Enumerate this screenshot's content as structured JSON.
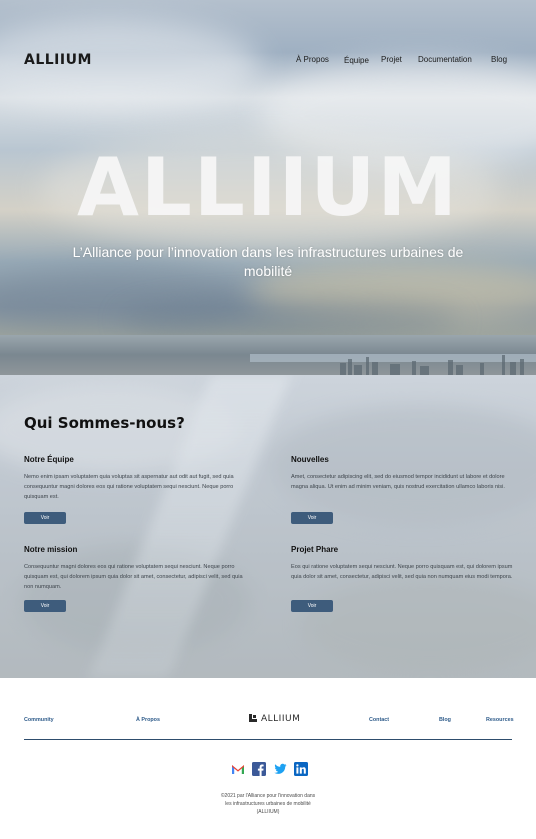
{
  "brand": {
    "logo_text": "ALLIIUM"
  },
  "nav": {
    "items": [
      "À Propos",
      "Équipe",
      "Projet",
      "Documentation",
      "Blog"
    ]
  },
  "hero": {
    "title": "ALLIIUM",
    "subtitle": "L’Alliance pour l’innovation dans les infrastructures urbaines de mobilité"
  },
  "about": {
    "title": "Qui Sommes-nous?",
    "cards": [
      {
        "title": "Notre Équipe",
        "text": "Nemo enim ipsam voluptatem quia voluptas sit aspernatur aut odit aut fugit, sed quia consequuntur magni dolores eos qui ratione voluptatem sequi nesciunt. Neque porro quisquam est.",
        "button": "Voir"
      },
      {
        "title": "Nouvelles",
        "text": "Amet, consectetur adipiscing elit, sed do eiusmod tempor incididunt ut labore et dolore magna aliqua. Ut enim ad minim veniam, quis nostrud exercitation ullamco laboris nisi.",
        "button": "Voir"
      },
      {
        "title": "Notre mission",
        "text": "Consequuntur magni dolores eos qui ratione voluptatem sequi nesciunt. Neque porro quisquam est, qui dolorem ipsum quia dolor sit amet, consectetur, adipisci velit, sed quia non numquam.",
        "button": "Voir"
      },
      {
        "title": "Projet Phare",
        "text": "Eos qui ratione voluptatem sequi nesciunt. Neque porro quisquam est, qui dolorem ipsum quia dolor sit amet, consectetur, adipisci velit, sed quia non numquam eius modi tempora.",
        "button": "Voir"
      }
    ]
  },
  "footer": {
    "links_left": [
      "Community",
      "À Propos"
    ],
    "logo_text": "ALLIIUM",
    "links_right": [
      "Contact",
      "Blog",
      "Resources"
    ],
    "social": [
      "gmail-icon",
      "facebook-icon",
      "twitter-icon",
      "linkedin-icon"
    ],
    "copyright": "©2021 par l'Alliance pour l'innovation dans les infrastructures urbaines de mobilité (ALLIIUM)"
  },
  "colors": {
    "accent": "#3e5c7c",
    "footer_link": "#2e5b8a",
    "rule": "#2e4d6d"
  }
}
